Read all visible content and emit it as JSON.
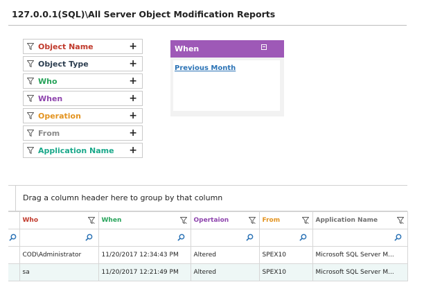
{
  "page": {
    "title": "127.0.0.1(SQL)\\All Server Object Modification Reports"
  },
  "filters": [
    {
      "label": "Object Name",
      "color": "#c0392b"
    },
    {
      "label": "Object Type",
      "color": "#2c3e50"
    },
    {
      "label": "Who",
      "color": "#27a35a"
    },
    {
      "label": "When",
      "color": "#8e44ad"
    },
    {
      "label": "Operation",
      "color": "#e3931f"
    },
    {
      "label": "From",
      "color": "#8a8a8a"
    },
    {
      "label": "Application Name",
      "color": "#19a88a"
    }
  ],
  "plus_symbol": "+",
  "when_panel": {
    "title": "When",
    "link": "Previous Month",
    "header_color": "#9e59b7"
  },
  "grid": {
    "group_hint": "Drag a column header here to group by that column",
    "columns": [
      {
        "label": "Who",
        "color": "#c0392b"
      },
      {
        "label": "When",
        "color": "#27a35a"
      },
      {
        "label": "Opertaion",
        "color": "#8e44ad"
      },
      {
        "label": "From",
        "color": "#e3931f"
      },
      {
        "label": "Application Name",
        "color": "#707070"
      }
    ],
    "rows": [
      {
        "who": "COD\\Administrator",
        "when": "11/20/2017 12:34:43 PM",
        "operation": "Altered",
        "from": "SPEX10",
        "app": "Microsoft SQL Server M..."
      },
      {
        "who": "sa",
        "when": "11/20/2017 12:21:49 PM",
        "operation": "Altered",
        "from": "SPEX10",
        "app": "Microsoft SQL Server M..."
      }
    ]
  }
}
